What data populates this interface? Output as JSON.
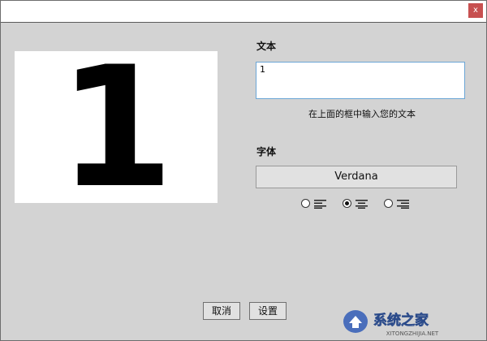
{
  "window": {
    "close_label": "x"
  },
  "preview": {
    "glyph": "1"
  },
  "text_section": {
    "label": "文本",
    "input_value": "1",
    "hint": "在上面的框中输入您的文本"
  },
  "font_section": {
    "label": "字体",
    "font_button_label": "Verdana"
  },
  "alignment": {
    "options": [
      "left",
      "center",
      "right"
    ],
    "selected": "center"
  },
  "buttons": {
    "cancel": "取消",
    "set": "设置"
  },
  "watermark": {
    "text": "系统之家",
    "url": "XITONGZHIJIA.NET"
  }
}
